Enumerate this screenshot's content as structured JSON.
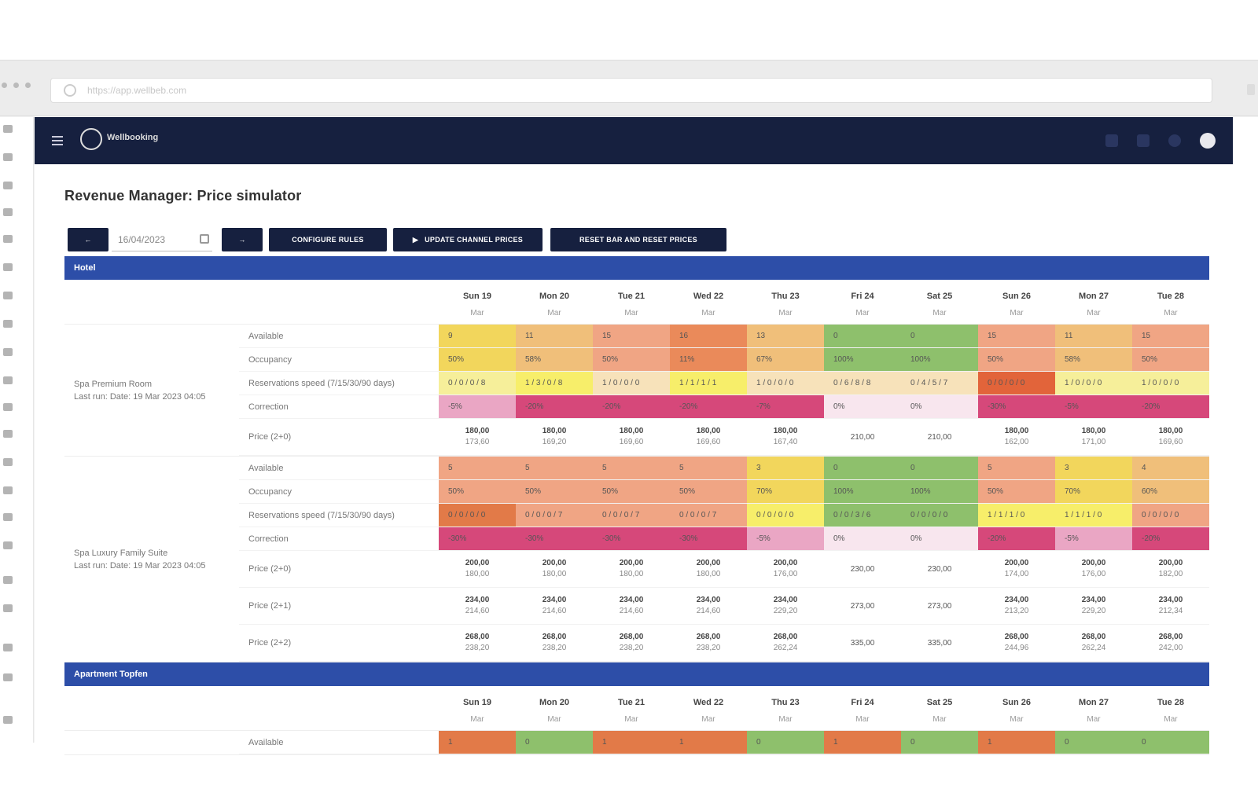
{
  "browser": {
    "url": "https://app.wellbeb.com"
  },
  "header": {
    "brand": "Wellbooking"
  },
  "page": {
    "title": "Revenue Manager: Price simulator"
  },
  "toolbar": {
    "prev_label": "←",
    "date_value": "16/04/2023",
    "next_label": "→",
    "config_label": "CONFIGURE RULES",
    "update_label": "UPDATE CHANNEL PRICES",
    "reset_label": "RESET BAR AND RESET PRICES"
  },
  "colors": {
    "yellow": "#f2d65c",
    "lightorange": "#f0bf7a",
    "salmon": "#f0a584",
    "orange": "#ea8a5a",
    "green": "#8ec06c",
    "paleyellow": "#f6ef9a",
    "brightyellow": "#f7ee6a",
    "paleorange": "#f7e2ba",
    "magenta": "#d6487a",
    "pink": "#eaa6c4",
    "palepink": "#f8e6ee",
    "deeporange": "#e2643a",
    "darkorange": "#e27a48",
    "navy": "#16203f",
    "blue": "#2d4ea8"
  },
  "sections": [
    {
      "name": "Hotel",
      "dates": [
        {
          "day": "Sun 19",
          "sub": "Mar"
        },
        {
          "day": "Mon 20",
          "sub": "Mar"
        },
        {
          "day": "Tue 21",
          "sub": "Mar"
        },
        {
          "day": "Wed 22",
          "sub": "Mar"
        },
        {
          "day": "Thu 23",
          "sub": "Mar"
        },
        {
          "day": "Fri 24",
          "sub": "Mar"
        },
        {
          "day": "Sat 25",
          "sub": "Mar"
        },
        {
          "day": "Sun 26",
          "sub": "Mar"
        },
        {
          "day": "Mon 27",
          "sub": "Mar"
        },
        {
          "day": "Tue 28",
          "sub": "Mar"
        }
      ],
      "rooms": [
        {
          "name": "Spa Premium Room",
          "updated": "Last run: Date: 19 Mar 2023 04:05",
          "rows": [
            {
              "label": "Available",
              "height": 29,
              "cells": [
                {
                  "v": "9",
                  "c": "yellow"
                },
                {
                  "v": "11",
                  "c": "lightorange"
                },
                {
                  "v": "15",
                  "c": "salmon"
                },
                {
                  "v": "16",
                  "c": "orange"
                },
                {
                  "v": "13",
                  "c": "lightorange"
                },
                {
                  "v": "0",
                  "c": "green"
                },
                {
                  "v": "0",
                  "c": "green"
                },
                {
                  "v": "15",
                  "c": "salmon"
                },
                {
                  "v": "11",
                  "c": "lightorange"
                },
                {
                  "v": "15",
                  "c": "salmon"
                }
              ]
            },
            {
              "label": "Occupancy",
              "height": 29,
              "cells": [
                {
                  "v": "50%",
                  "c": "yellow"
                },
                {
                  "v": "58%",
                  "c": "lightorange"
                },
                {
                  "v": "50%",
                  "c": "salmon"
                },
                {
                  "v": "11%",
                  "c": "orange"
                },
                {
                  "v": "67%",
                  "c": "lightorange"
                },
                {
                  "v": "100%",
                  "c": "green"
                },
                {
                  "v": "100%",
                  "c": "green"
                },
                {
                  "v": "50%",
                  "c": "salmon"
                },
                {
                  "v": "58%",
                  "c": "lightorange"
                },
                {
                  "v": "50%",
                  "c": "salmon"
                }
              ]
            },
            {
              "label": "Reservations speed (7/15/30/90 days)",
              "height": 29,
              "cells": [
                {
                  "v": "0 / 0 / 0 / 8",
                  "c": "paleyellow"
                },
                {
                  "v": "1 / 3 / 0 / 8",
                  "c": "brightyellow"
                },
                {
                  "v": "1 / 0 / 0 / 0",
                  "c": "paleorange"
                },
                {
                  "v": "1 / 1 / 1 / 1",
                  "c": "brightyellow"
                },
                {
                  "v": "1 / 0 / 0 / 0",
                  "c": "paleorange"
                },
                {
                  "v": "0 / 6 / 8 / 8",
                  "c": "paleorange"
                },
                {
                  "v": "0 / 4 / 5 / 7",
                  "c": "paleorange"
                },
                {
                  "v": "0 / 0 / 0 / 0",
                  "c": "deeporange"
                },
                {
                  "v": "1 / 0 / 0 / 0",
                  "c": "paleyellow"
                },
                {
                  "v": "1 / 0 / 0 / 0",
                  "c": "paleyellow"
                }
              ]
            },
            {
              "label": "Correction",
              "height": 29,
              "cells": [
                {
                  "v": "-5%",
                  "c": "pink"
                },
                {
                  "v": "-20%",
                  "c": "magenta"
                },
                {
                  "v": "-20%",
                  "c": "magenta"
                },
                {
                  "v": "-20%",
                  "c": "magenta"
                },
                {
                  "v": "-7%",
                  "c": "magenta"
                },
                {
                  "v": "0%",
                  "c": "palepink"
                },
                {
                  "v": "0%",
                  "c": "palepink"
                },
                {
                  "v": "-30%",
                  "c": "magenta"
                },
                {
                  "v": "-5%",
                  "c": "magenta"
                },
                {
                  "v": "-20%",
                  "c": "magenta"
                }
              ]
            },
            {
              "label": "Price (2+0)",
              "height": 46,
              "cells": [
                {
                  "a": "180,00",
                  "b": "173,60",
                  "c": ""
                },
                {
                  "a": "180,00",
                  "b": "169,20",
                  "c": ""
                },
                {
                  "a": "180,00",
                  "b": "169,60",
                  "c": ""
                },
                {
                  "a": "180,00",
                  "b": "169,60",
                  "c": ""
                },
                {
                  "a": "180,00",
                  "b": "167,40",
                  "c": ""
                },
                {
                  "single": "210,00",
                  "c": ""
                },
                {
                  "single": "210,00",
                  "c": ""
                },
                {
                  "a": "180,00",
                  "b": "162,00",
                  "c": ""
                },
                {
                  "a": "180,00",
                  "b": "171,00",
                  "c": ""
                },
                {
                  "a": "180,00",
                  "b": "169,60",
                  "c": ""
                }
              ]
            }
          ]
        },
        {
          "name": "Spa Luxury Family Suite",
          "updated": "Last run: Date: 19 Mar 2023 04:05",
          "rows": [
            {
              "label": "Available",
              "height": 29,
              "cells": [
                {
                  "v": "5",
                  "c": "salmon"
                },
                {
                  "v": "5",
                  "c": "salmon"
                },
                {
                  "v": "5",
                  "c": "salmon"
                },
                {
                  "v": "5",
                  "c": "salmon"
                },
                {
                  "v": "3",
                  "c": "yellow"
                },
                {
                  "v": "0",
                  "c": "green"
                },
                {
                  "v": "0",
                  "c": "green"
                },
                {
                  "v": "5",
                  "c": "salmon"
                },
                {
                  "v": "3",
                  "c": "yellow"
                },
                {
                  "v": "4",
                  "c": "lightorange"
                }
              ]
            },
            {
              "label": "Occupancy",
              "height": 29,
              "cells": [
                {
                  "v": "50%",
                  "c": "salmon"
                },
                {
                  "v": "50%",
                  "c": "salmon"
                },
                {
                  "v": "50%",
                  "c": "salmon"
                },
                {
                  "v": "50%",
                  "c": "salmon"
                },
                {
                  "v": "70%",
                  "c": "yellow"
                },
                {
                  "v": "100%",
                  "c": "green"
                },
                {
                  "v": "100%",
                  "c": "green"
                },
                {
                  "v": "50%",
                  "c": "salmon"
                },
                {
                  "v": "70%",
                  "c": "yellow"
                },
                {
                  "v": "60%",
                  "c": "lightorange"
                }
              ]
            },
            {
              "label": "Reservations speed (7/15/30/90 days)",
              "height": 29,
              "cells": [
                {
                  "v": "0 / 0 / 0 / 0",
                  "c": "darkorange"
                },
                {
                  "v": "0 / 0 / 0 / 7",
                  "c": "salmon"
                },
                {
                  "v": "0 / 0 / 0 / 7",
                  "c": "salmon"
                },
                {
                  "v": "0 / 0 / 0 / 7",
                  "c": "salmon"
                },
                {
                  "v": "0 / 0 / 0 / 0",
                  "c": "brightyellow"
                },
                {
                  "v": "0 / 0 / 3 / 6",
                  "c": "green"
                },
                {
                  "v": "0 / 0 / 0 / 0",
                  "c": "green"
                },
                {
                  "v": "1 / 1 / 1 / 0",
                  "c": "brightyellow"
                },
                {
                  "v": "1 / 1 / 1 / 0",
                  "c": "brightyellow"
                },
                {
                  "v": "0 / 0 / 0 / 0",
                  "c": "salmon"
                }
              ]
            },
            {
              "label": "Correction",
              "height": 29,
              "cells": [
                {
                  "v": "-30%",
                  "c": "magenta"
                },
                {
                  "v": "-30%",
                  "c": "magenta"
                },
                {
                  "v": "-30%",
                  "c": "magenta"
                },
                {
                  "v": "-30%",
                  "c": "magenta"
                },
                {
                  "v": "-5%",
                  "c": "pink"
                },
                {
                  "v": "0%",
                  "c": "palepink"
                },
                {
                  "v": "0%",
                  "c": "palepink"
                },
                {
                  "v": "-20%",
                  "c": "magenta"
                },
                {
                  "v": "-5%",
                  "c": "pink"
                },
                {
                  "v": "-20%",
                  "c": "magenta"
                }
              ]
            },
            {
              "label": "Price (2+0)",
              "height": 46,
              "cells": [
                {
                  "a": "200,00",
                  "b": "180,00",
                  "c": ""
                },
                {
                  "a": "200,00",
                  "b": "180,00",
                  "c": ""
                },
                {
                  "a": "200,00",
                  "b": "180,00",
                  "c": ""
                },
                {
                  "a": "200,00",
                  "b": "180,00",
                  "c": ""
                },
                {
                  "a": "200,00",
                  "b": "176,00",
                  "c": ""
                },
                {
                  "single": "230,00",
                  "c": ""
                },
                {
                  "single": "230,00",
                  "c": ""
                },
                {
                  "a": "200,00",
                  "b": "174,00",
                  "c": ""
                },
                {
                  "a": "200,00",
                  "b": "176,00",
                  "c": ""
                },
                {
                  "a": "200,00",
                  "b": "182,00",
                  "c": ""
                }
              ]
            },
            {
              "label": "Price (2+1)",
              "height": 46,
              "cells": [
                {
                  "a": "234,00",
                  "b": "214,60",
                  "c": ""
                },
                {
                  "a": "234,00",
                  "b": "214,60",
                  "c": ""
                },
                {
                  "a": "234,00",
                  "b": "214,60",
                  "c": ""
                },
                {
                  "a": "234,00",
                  "b": "214,60",
                  "c": ""
                },
                {
                  "a": "234,00",
                  "b": "229,20",
                  "c": ""
                },
                {
                  "single": "273,00",
                  "c": ""
                },
                {
                  "single": "273,00",
                  "c": ""
                },
                {
                  "a": "234,00",
                  "b": "213,20",
                  "c": ""
                },
                {
                  "a": "234,00",
                  "b": "229,20",
                  "c": ""
                },
                {
                  "a": "234,00",
                  "b": "212,34",
                  "c": ""
                }
              ]
            },
            {
              "label": "Price (2+2)",
              "height": 46,
              "cells": [
                {
                  "a": "268,00",
                  "b": "238,20",
                  "c": ""
                },
                {
                  "a": "268,00",
                  "b": "238,20",
                  "c": ""
                },
                {
                  "a": "268,00",
                  "b": "238,20",
                  "c": ""
                },
                {
                  "a": "268,00",
                  "b": "238,20",
                  "c": ""
                },
                {
                  "a": "268,00",
                  "b": "262,24",
                  "c": ""
                },
                {
                  "single": "335,00",
                  "c": ""
                },
                {
                  "single": "335,00",
                  "c": ""
                },
                {
                  "a": "268,00",
                  "b": "244,96",
                  "c": ""
                },
                {
                  "a": "268,00",
                  "b": "262,24",
                  "c": ""
                },
                {
                  "a": "268,00",
                  "b": "242,00",
                  "c": ""
                }
              ]
            }
          ]
        }
      ]
    },
    {
      "name": "Apartment Topfen",
      "dates": [
        {
          "day": "Sun 19",
          "sub": "Mar"
        },
        {
          "day": "Mon 20",
          "sub": "Mar"
        },
        {
          "day": "Tue 21",
          "sub": "Mar"
        },
        {
          "day": "Wed 22",
          "sub": "Mar"
        },
        {
          "day": "Thu 23",
          "sub": "Mar"
        },
        {
          "day": "Fri 24",
          "sub": "Mar"
        },
        {
          "day": "Sat 25",
          "sub": "Mar"
        },
        {
          "day": "Sun 26",
          "sub": "Mar"
        },
        {
          "day": "Mon 27",
          "sub": "Mar"
        },
        {
          "day": "Tue 28",
          "sub": "Mar"
        }
      ],
      "rooms": [
        {
          "name": "",
          "updated": "",
          "rows": [
            {
              "label": "Available",
              "height": 29,
              "cells": [
                {
                  "v": "1",
                  "c": "darkorange"
                },
                {
                  "v": "0",
                  "c": "green"
                },
                {
                  "v": "1",
                  "c": "darkorange"
                },
                {
                  "v": "1",
                  "c": "darkorange"
                },
                {
                  "v": "0",
                  "c": "green"
                },
                {
                  "v": "1",
                  "c": "darkorange"
                },
                {
                  "v": "0",
                  "c": "green"
                },
                {
                  "v": "1",
                  "c": "darkorange"
                },
                {
                  "v": "0",
                  "c": "green"
                },
                {
                  "v": "0",
                  "c": "green"
                }
              ]
            }
          ]
        }
      ]
    }
  ]
}
